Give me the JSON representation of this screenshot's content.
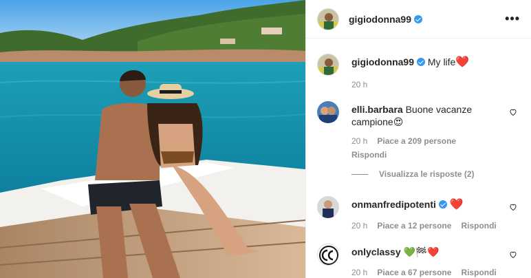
{
  "post": {
    "author": "gigiodonna99",
    "caption": "My life",
    "caption_emoji": "❤️",
    "time": "20 h"
  },
  "header": {
    "username": "gigiodonna99",
    "more_icon": "more-horizontal-icon",
    "more_label": "•••"
  },
  "comments": [
    {
      "username": "elli.barbara",
      "text": "Buone vacanze campione",
      "emoji": "😍",
      "time": "20 h",
      "likes": "Piace a 209 persone",
      "reply": "Rispondi",
      "view_replies": "Visualizza le risposte (2)"
    },
    {
      "username": "onmanfredipotenti",
      "emoji": "❤️",
      "time": "20 h",
      "likes": "Piace a 12 persone",
      "reply": "Rispondi"
    },
    {
      "username": "onlyclassy",
      "emoji": "💚🏁❤️",
      "time": "20 h",
      "likes": "Piace a 67 persone",
      "reply": "Rispondi"
    }
  ],
  "colors": {
    "verified": "#3897f0",
    "heart": "#ed1b2e",
    "secondary_text": "#8e8e8e",
    "sea": "#1fa4b6"
  }
}
